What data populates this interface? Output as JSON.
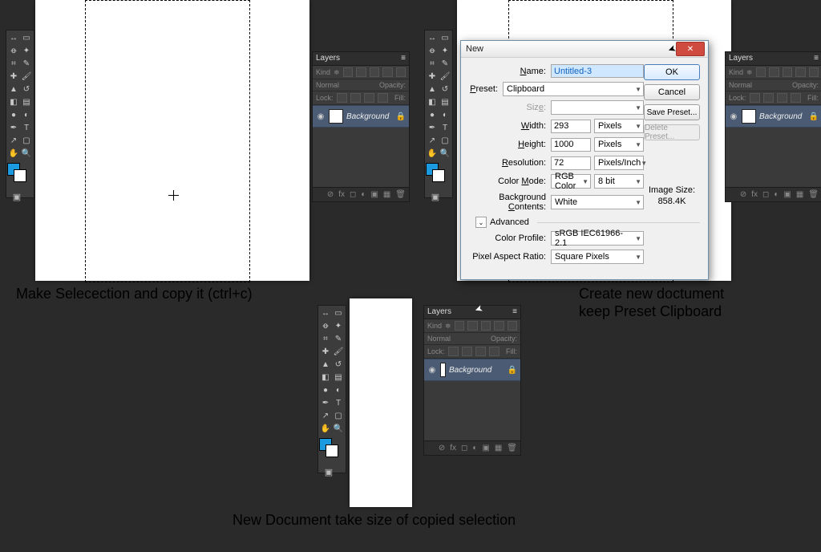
{
  "captions": {
    "left": "Make Selecection and copy it (ctrl+c)",
    "right_l1": "Create new doctument",
    "right_l2": "keep Preset Clipboard",
    "bottom": "New Document take size of copied selection"
  },
  "layers": {
    "title": "Layers",
    "kind": "Kind",
    "blend": "Normal",
    "opacity_label": "Opacity:",
    "lock_label": "Lock:",
    "fill_label": "Fill:",
    "layer_name": "Background"
  },
  "dialog": {
    "title": "New",
    "labels": {
      "name": "Name:",
      "preset": "Preset:",
      "size": "Size:",
      "width": "Width:",
      "height": "Height:",
      "resolution": "Resolution:",
      "color_mode": "Color Mode:",
      "bg": "Background Contents:",
      "advanced": "Advanced",
      "color_profile": "Color Profile:",
      "par": "Pixel Aspect Ratio:",
      "image_size": "Image Size:"
    },
    "values": {
      "name": "Untitled-3",
      "preset": "Clipboard",
      "size": "",
      "width": "293",
      "width_unit": "Pixels",
      "height": "1000",
      "height_unit": "Pixels",
      "resolution": "72",
      "resolution_unit": "Pixels/Inch",
      "color_mode": "RGB Color",
      "bit_depth": "8 bit",
      "bg": "White",
      "color_profile": "sRGB IEC61966-2.1",
      "par": "Square Pixels",
      "image_size": "858.4K"
    },
    "buttons": {
      "ok": "OK",
      "cancel": "Cancel",
      "save_preset": "Save Preset...",
      "delete_preset": "Delete Preset..."
    }
  }
}
